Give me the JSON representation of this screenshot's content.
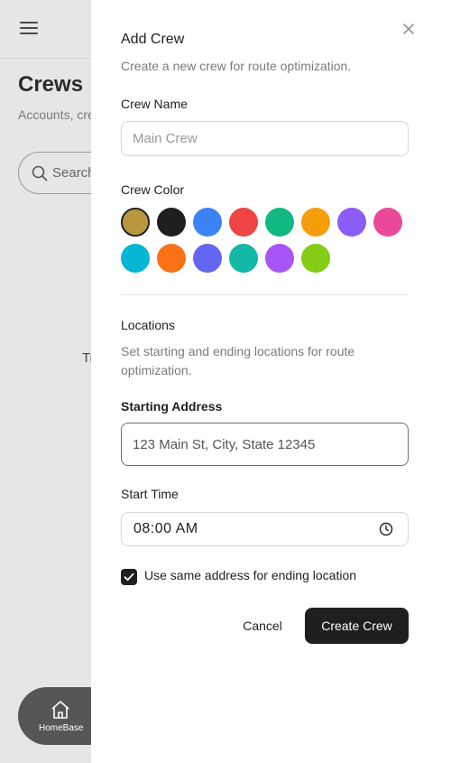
{
  "background": {
    "page_title": "Crews",
    "subtitle": "Accounts, cre business.",
    "search_placeholder": "Search",
    "partial_text": "Tr",
    "nav": {
      "home_label": "HomeBase"
    }
  },
  "drawer": {
    "title": "Add Crew",
    "subtitle": "Create a new crew for route optimization.",
    "crew_name": {
      "label": "Crew Name",
      "placeholder": "Main Crew",
      "value": ""
    },
    "crew_color": {
      "label": "Crew Color",
      "selected_index": 0,
      "colors": [
        "#b8973e",
        "#1f1f1f",
        "#3b82f6",
        "#ef4444",
        "#10b981",
        "#f59e0b",
        "#8b5cf6",
        "#ec4899",
        "#06b6d4",
        "#f97316",
        "#6366f1",
        "#14b8a6",
        "#a855f7",
        "#84cc16"
      ]
    },
    "locations": {
      "title": "Locations",
      "description": "Set starting and ending locations for route optimization."
    },
    "starting_address": {
      "label": "Starting Address",
      "placeholder": "123 Main St, City, State 12345",
      "value": ""
    },
    "start_time": {
      "label": "Start Time",
      "value": "08:00 AM"
    },
    "same_address": {
      "label": "Use same address for ending location",
      "checked": true
    },
    "buttons": {
      "cancel": "Cancel",
      "create": "Create Crew"
    }
  }
}
